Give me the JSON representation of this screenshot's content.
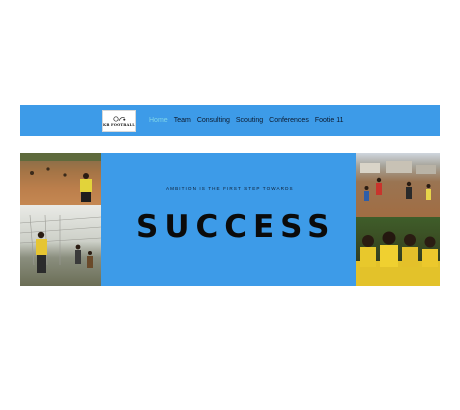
{
  "header": {
    "logo_text": "KB FOOTBALL",
    "nav_items": [
      "Home",
      "Team",
      "Consulting",
      "Scouting",
      "Conferences",
      "Footie 11"
    ],
    "active_index": 0
  },
  "hero": {
    "tagline": "AMBITION IS THE FIRST STEP TOWARDS",
    "headline": "SUCCESS"
  },
  "colors": {
    "brand_blue": "#3d9be8",
    "active_nav": "#7fd6e8",
    "text_dark": "#0c1a2e"
  }
}
